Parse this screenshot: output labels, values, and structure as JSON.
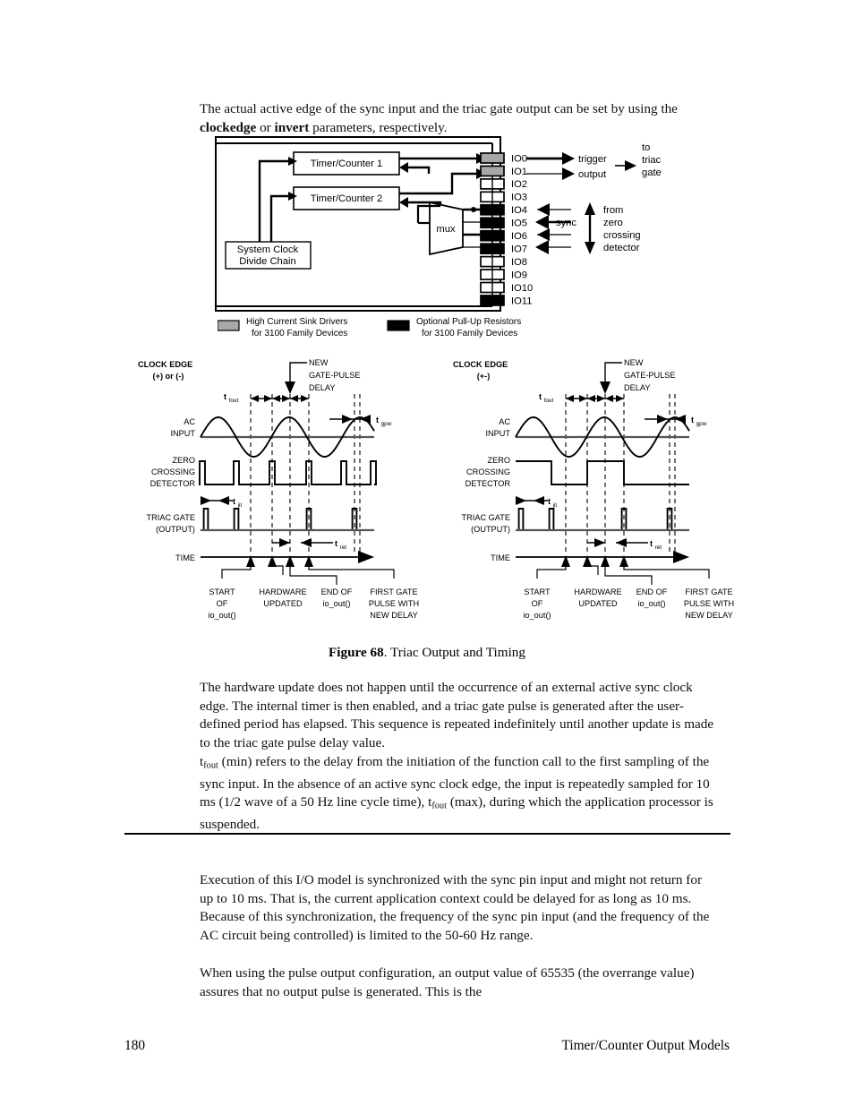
{
  "document": {
    "intro_paragraph_pre": "The actual active edge of the sync input and the triac gate output can be set by using the ",
    "intro_bold_1": "clockedge",
    "intro_mid": " or ",
    "intro_bold_2": "invert",
    "intro_paragraph_post": " parameters, respectively.",
    "figure_number": "Figure 68",
    "figure_title": ". Triac Output and Timing",
    "paragraph_hardware": "The hardware update does not happen until the occurrence of an external active sync clock edge.  The internal timer is then enabled, and a triac gate pulse is generated after the user-defined period has elapsed.  This sequence is repeated indefinitely until another update is made to the triac gate pulse delay value.",
    "paragraph_tfout_pre": "t",
    "paragraph_tfout_sub": "fout",
    "paragraph_tfout_post": " (min) refers to the delay from the initiation of the function call to the first sampling of the sync input.  In the absence of an active sync clock edge, the input is repeatedly sampled for 10 ms (1/2 wave of a 50 Hz line cycle time), t",
    "paragraph_tfout_sub2": "fout",
    "paragraph_tfout_end": " (max), during which the application processor is suspended.",
    "paragraph_execution": "Execution of this I/O model is synchronized with the sync pin input and might not return for up to 10 ms.  That is, the current application context could be delayed for as long as 10 ms.  Because of this synchronization, the frequency of the sync pin input (and the frequency of the AC circuit being controlled) is limited to the 50-60 Hz range.",
    "paragraph_pulse": "When using the pulse output configuration, an output value of 65535 (the overrange value) assures that no output pulse is generated.  This is the",
    "footer_page_number": "180",
    "footer_section_title": "Timer/Counter Output Models"
  },
  "block_diagram": {
    "timer1_label": "Timer/Counter 1",
    "timer2_label": "Timer/Counter 2",
    "system_clock_line1": "System Clock",
    "system_clock_line2": "Divide Chain",
    "mux_label": "mux",
    "pins": [
      {
        "name": "IO0",
        "fill": "#a8a8a8"
      },
      {
        "name": "IO1",
        "fill": "#a8a8a8"
      },
      {
        "name": "IO2",
        "fill": "#ffffff"
      },
      {
        "name": "IO3",
        "fill": "#ffffff"
      },
      {
        "name": "IO4",
        "fill": "#000000"
      },
      {
        "name": "IO5",
        "fill": "#000000"
      },
      {
        "name": "IO6",
        "fill": "#000000"
      },
      {
        "name": "IO7",
        "fill": "#000000"
      },
      {
        "name": "IO8",
        "fill": "#ffffff"
      },
      {
        "name": "IO9",
        "fill": "#ffffff"
      },
      {
        "name": "IO10",
        "fill": "#ffffff"
      },
      {
        "name": "IO11",
        "fill": "#000000"
      }
    ],
    "trigger_label": "trigger",
    "output_label": "output",
    "to_triac_gate": [
      "to",
      "triac",
      "gate"
    ],
    "sync_label": "sync",
    "from_zero_crossing": [
      "from",
      "zero",
      "crossing",
      "detector"
    ],
    "legend": [
      {
        "swatch": "#a8a8a8",
        "line1": "High Current Sink Drivers",
        "line2": "for 3100 Family Devices"
      },
      {
        "swatch": "#000000",
        "line1": "Optional Pull-Up Resistors",
        "line2": "for 3100 Family Devices"
      }
    ]
  },
  "timing": {
    "left": {
      "clock_edge_title": "CLOCK EDGE",
      "clock_edge_sub": "(+) or (-)",
      "new_gate_pulse_delay": [
        "NEW",
        "GATE-PULSE",
        "DELAY"
      ],
      "t_fout": "t",
      "t_fout_sub": "fout",
      "t_gpw": "t",
      "t_gpw_sub": "gpw",
      "t_jit": "t",
      "t_jit_sub": "jit",
      "t_ret": "t",
      "t_ret_sub": "ret",
      "row_ac": [
        "AC",
        "INPUT"
      ],
      "row_zcd": [
        "ZERO",
        "CROSSING",
        "DETECTOR"
      ],
      "row_triac": [
        "TRIAC GATE",
        "(OUTPUT)"
      ],
      "row_time": "TIME",
      "zcd_style": "pulse",
      "annotations": [
        [
          "START",
          "OF",
          "io_out()"
        ],
        [
          "HARDWARE",
          "UPDATED"
        ],
        [
          "END OF",
          "io_out()"
        ],
        [
          "FIRST GATE",
          "PULSE WITH",
          "NEW DELAY"
        ]
      ]
    },
    "right": {
      "clock_edge_title": "CLOCK EDGE",
      "clock_edge_sub": "(+-)",
      "new_gate_pulse_delay": [
        "NEW",
        "GATE-PULSE",
        "DELAY"
      ],
      "t_fout": "t",
      "t_fout_sub": "fout",
      "t_gpw": "t",
      "t_gpw_sub": "gpw",
      "t_jit": "t",
      "t_jit_sub": "jit",
      "t_ret": "t",
      "t_ret_sub": "ret",
      "row_ac": [
        "AC",
        "INPUT"
      ],
      "row_zcd": [
        "ZERO",
        "CROSSING",
        "DETECTOR"
      ],
      "row_triac": [
        "TRIAC GATE",
        "(OUTPUT)"
      ],
      "row_time": "TIME",
      "zcd_style": "square",
      "annotations": [
        [
          "START",
          "OF",
          "io_out()"
        ],
        [
          "HARDWARE",
          "UPDATED"
        ],
        [
          "END OF",
          "io_out()"
        ],
        [
          "FIRST GATE",
          "PULSE WITH",
          "NEW DELAY"
        ]
      ]
    }
  }
}
